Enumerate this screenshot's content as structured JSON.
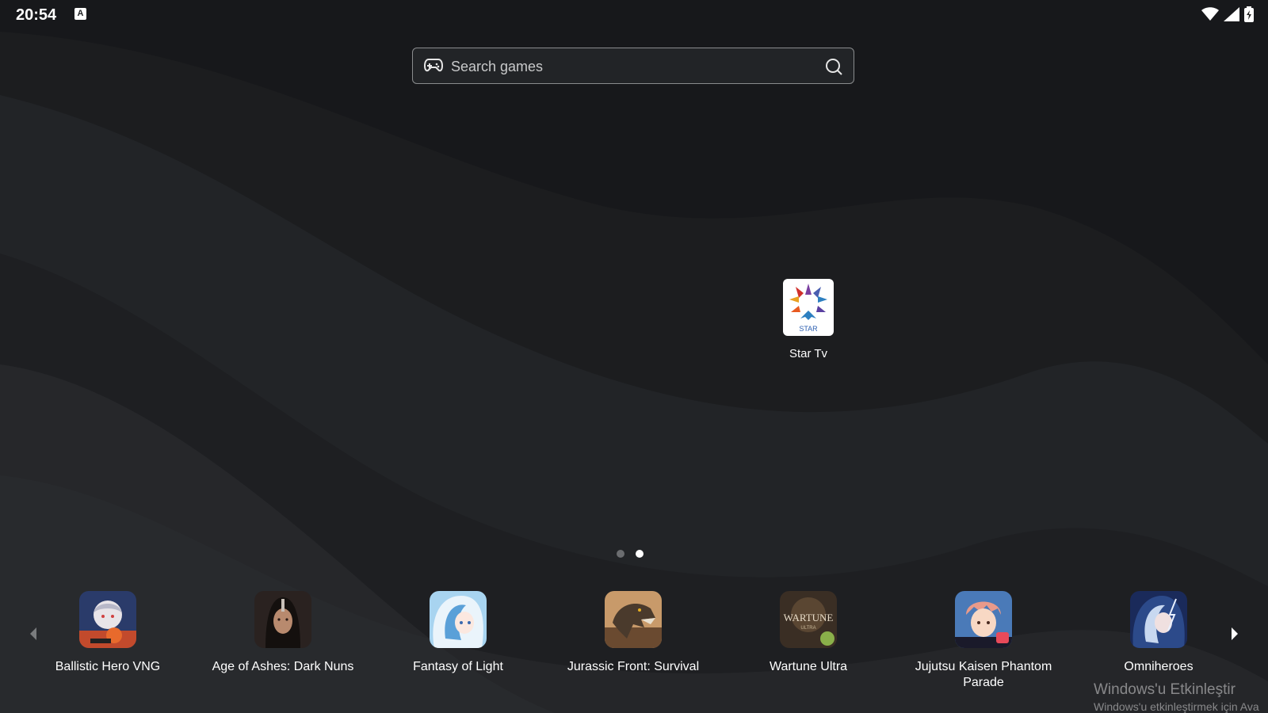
{
  "status_bar": {
    "time": "20:54",
    "notification_icon": "A",
    "indicators": [
      "wifi-icon",
      "signal-icon",
      "battery-icon"
    ]
  },
  "search": {
    "placeholder": "Search games"
  },
  "desktop": {
    "apps": [
      {
        "label": "Star Tv",
        "icon": "star-tv-icon"
      }
    ]
  },
  "pager": {
    "pages": 2,
    "active_page": 2
  },
  "dock": {
    "apps": [
      {
        "label": "Ballistic Hero VNG",
        "icon": "ballistic-hero-icon",
        "color": "#c24a2c"
      },
      {
        "label": "Age of Ashes: Dark Nuns",
        "icon": "age-of-ashes-icon",
        "color": "#3a2a26"
      },
      {
        "label": "Fantasy of Light",
        "icon": "fantasy-of-light-icon",
        "color": "#8fc3e8"
      },
      {
        "label": "Jurassic Front: Survival",
        "icon": "jurassic-front-icon",
        "color": "#7a5a3e"
      },
      {
        "label": "Wartune Ultra",
        "icon": "wartune-ultra-icon",
        "color": "#4a3a2c"
      },
      {
        "label": "Jujutsu Kaisen Phantom Parade",
        "icon": "jujutsu-kaisen-icon",
        "color": "#d4553c"
      },
      {
        "label": "Omniheroes",
        "icon": "omniheroes-icon",
        "color": "#2c4a8a"
      }
    ]
  },
  "watermark": {
    "title": "Windows'u Etkinleştir",
    "subtitle": "Windows'u etkinleştirmek için Ava"
  }
}
